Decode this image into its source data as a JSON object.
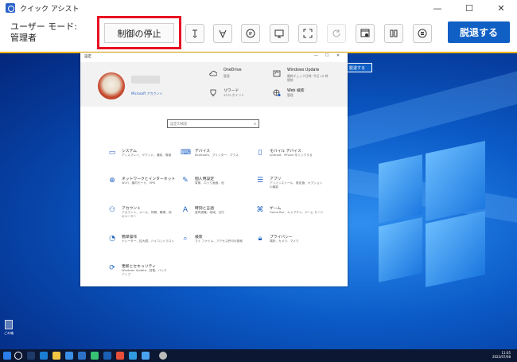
{
  "app": {
    "title": "クイック アシスト"
  },
  "toolbar": {
    "mode_line1": "ユーザー モード:",
    "mode_line2": "管理者",
    "stop_label": "制御の停止",
    "leave_label": "脱退する",
    "tool_icons": [
      "pen-icon",
      "laser-pointer-icon",
      "chat-icon",
      "display-icon",
      "fullscreen-icon",
      "reload-icon",
      "task-manager-icon",
      "pause-icon",
      "menu-icon"
    ]
  },
  "remote": {
    "leave_label": "脱退する",
    "recycle_bin_label": "ごみ箱",
    "taskbar": {
      "time": "11:05",
      "date": "2022/07/08"
    }
  },
  "settings": {
    "title": "設定",
    "account_link": "Microsoft アカウント",
    "header_items": [
      {
        "name": "onedrive",
        "title": "OneDrive",
        "sub": "管理",
        "icon": "cloud-icon"
      },
      {
        "name": "windows-update",
        "title": "Windows Update",
        "sub": "最終チェック日時: 今日 18 時\n間前",
        "icon": "update-icon"
      },
      {
        "name": "rewards",
        "title": "リワード",
        "sub": "3375 ポイント",
        "icon": "trophy-icon"
      },
      {
        "name": "web-search",
        "title": "Web 検索",
        "sub": "管理",
        "icon": "globe-icon"
      }
    ],
    "search_placeholder": "設定の検索",
    "categories": [
      {
        "name": "system",
        "title": "システム",
        "sub": "ディスプレイ、サウンド、通知、電源",
        "icon": "laptop-icon",
        "glyph": "▭"
      },
      {
        "name": "devices",
        "title": "デバイス",
        "sub": "Bluetooth、プリンター、マウス",
        "icon": "keyboard-icon",
        "glyph": "⌨"
      },
      {
        "name": "phone",
        "title": "モバイル デバイス",
        "sub": "Android、iPhone をリンクする",
        "icon": "phone-icon",
        "glyph": "▯"
      },
      {
        "name": "network",
        "title": "ネットワークとインターネット",
        "sub": "Wi-Fi、機内モード、VPN",
        "icon": "globe-icon",
        "glyph": "⊕"
      },
      {
        "name": "personalization",
        "title": "個人用設定",
        "sub": "背景、ロック画面、色",
        "icon": "brush-icon",
        "glyph": "✎"
      },
      {
        "name": "apps",
        "title": "アプリ",
        "sub": "アンインストール、既定値、オプション\nの機能",
        "icon": "apps-list-icon",
        "glyph": "☰"
      },
      {
        "name": "accounts",
        "title": "アカウント",
        "sub": "アカウント、メール、同期、職場、他\nのユーザー",
        "icon": "person-icon",
        "glyph": "⚇"
      },
      {
        "name": "time-language",
        "title": "時刻と言語",
        "sub": "音声認識、地域、日付",
        "icon": "time-language-icon",
        "glyph": "A"
      },
      {
        "name": "gaming",
        "title": "ゲーム",
        "sub": "Game Bar、キャプチャ、ゲーム モード",
        "icon": "gamepad-icon",
        "glyph": "⌘"
      },
      {
        "name": "ease-of-access",
        "title": "簡単操作",
        "sub": "ナレーター、拡大鏡、ハイコントラスト",
        "icon": "ease-of-access-icon",
        "glyph": "◔"
      },
      {
        "name": "search",
        "title": "検索",
        "sub": "マイ ファイル、アクセス許可の検索",
        "icon": "magnifier-icon",
        "glyph": "⌕"
      },
      {
        "name": "privacy",
        "title": "プライバシー",
        "sub": "場所、カメラ、マイク",
        "icon": "lock-icon",
        "glyph": "🔒︎"
      },
      {
        "name": "update-security",
        "title": "更新とセキュリティ",
        "sub": "Windows Update、回復、バック\nアップ",
        "icon": "sync-icon",
        "glyph": "⟳"
      }
    ]
  },
  "colors": {
    "accent": "#0f5fc4",
    "highlight_red": "#e81123",
    "remote_border": "#f2b400",
    "taskbar": "#0c1733"
  }
}
